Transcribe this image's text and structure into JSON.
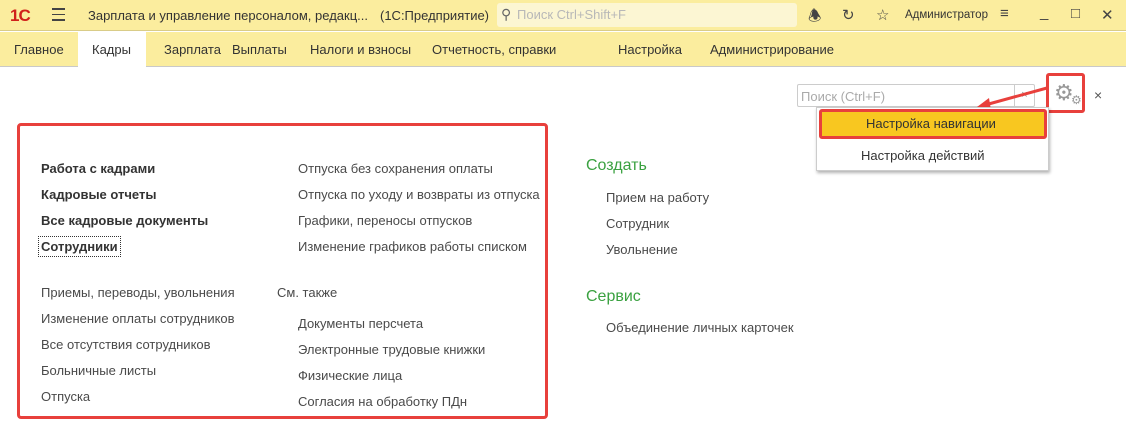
{
  "window": {
    "logo": "1С",
    "title": "Зарплата и управление персоналом, редакц...",
    "subtitle": "(1С:Предприятие)",
    "search_placeholder": "Поиск Ctrl+Shift+F",
    "user": "Администратор"
  },
  "tabs": [
    "Главное",
    "Кадры",
    "Зарплата",
    "Выплаты",
    "Налоги и взносы",
    "Отчетность, справки",
    "Настройка",
    "Администрирование"
  ],
  "page": {
    "search_placeholder": "Поиск (Ctrl+F)",
    "search_clear": "×",
    "close": "×"
  },
  "settings_menu": [
    "Настройка навигации",
    "Настройка действий"
  ],
  "nav": {
    "bold": [
      "Работа с кадрами",
      "Кадровые отчеты",
      "Все кадровые документы",
      "Сотрудники"
    ],
    "col1": [
      "Приемы, переводы, увольнения",
      "Изменение оплаты сотрудников",
      "Все отсутствия сотрудников",
      "Больничные листы",
      "Отпуска"
    ],
    "col2": [
      "Отпуска без сохранения оплаты",
      "Отпуска по уходу и возвраты из отпуска",
      "Графики, переносы отпусков",
      "Изменение графиков работы списком"
    ],
    "see_also_label": "См. также",
    "see_also": [
      "Документы персчета",
      "Электронные трудовые книжки",
      "Физические лица",
      "Согласия на обработку ПДн"
    ]
  },
  "create": {
    "title": "Создать",
    "items": [
      "Прием на работу",
      "Сотрудник",
      "Увольнение"
    ]
  },
  "service": {
    "title": "Сервис",
    "items": [
      "Объединение личных карточек"
    ]
  }
}
